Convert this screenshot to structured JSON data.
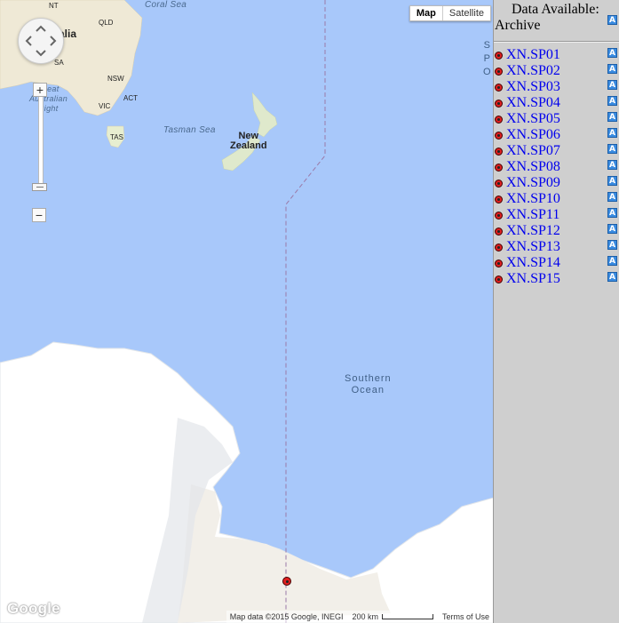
{
  "map": {
    "type_buttons": [
      {
        "label": "Map",
        "active": true
      },
      {
        "label": "Satellite",
        "active": false
      }
    ],
    "labels": {
      "coral_sea": "Coral Sea",
      "tasman_sea": "Tasman Sea",
      "nt": "NT",
      "qld": "QLD",
      "sa": "SA",
      "nsw": "NSW",
      "act": "ACT",
      "vic": "VIC",
      "tas": "TAS",
      "australia_partial": "alia",
      "great_australian_bight": [
        "Great",
        "Australian",
        "Bight"
      ],
      "new_zealand": [
        "New",
        "Zealand"
      ],
      "southern_ocean": [
        "Southern",
        "Ocean"
      ],
      "pacific_partial": [
        "S",
        "P",
        "O"
      ]
    },
    "zoom": {
      "plus": "+",
      "minus": "−"
    },
    "logo": "Google",
    "footer": {
      "attribution": "Map data ©2015 Google, INEGI",
      "scale": "200 km",
      "terms": "Terms of Use"
    },
    "colors": {
      "water": "#a8c8fa",
      "land": "#f2efe9",
      "ice": "#ffffff",
      "marker": "#e02020"
    }
  },
  "panel": {
    "heading_line1": "Data Available:",
    "heading_line2": "Archive",
    "badge": "A",
    "stations": [
      "XN.SP01",
      "XN.SP02",
      "XN.SP03",
      "XN.SP04",
      "XN.SP05",
      "XN.SP06",
      "XN.SP07",
      "XN.SP08",
      "XN.SP09",
      "XN.SP10",
      "XN.SP11",
      "XN.SP12",
      "XN.SP13",
      "XN.SP14",
      "XN.SP15"
    ]
  }
}
